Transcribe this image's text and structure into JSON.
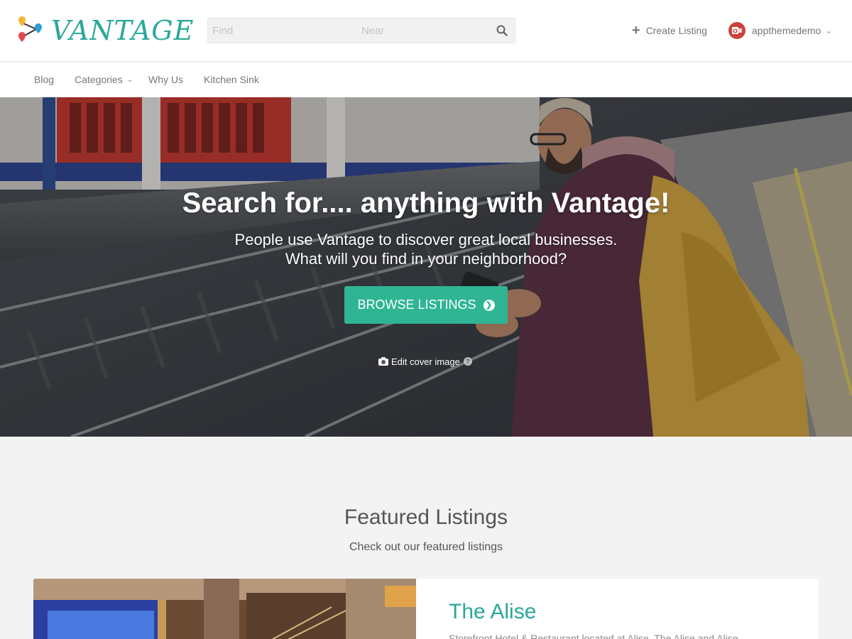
{
  "brand": {
    "name": "VANTAGE",
    "color": "#2aa89a"
  },
  "search": {
    "find_placeholder": "Find",
    "near_placeholder": "Near",
    "icon": "search-icon"
  },
  "header": {
    "create_listing_label": "Create Listing",
    "username": "appthemedemo"
  },
  "nav": {
    "items": [
      {
        "label": "Blog"
      },
      {
        "label": "Categories",
        "has_dropdown": true
      },
      {
        "label": "Why Us"
      },
      {
        "label": "Kitchen Sink"
      }
    ]
  },
  "hero": {
    "title": "Search for.... anything with Vantage!",
    "subtitle_line1": "People use Vantage to discover great local businesses.",
    "subtitle_line2": "What will you find in your neighborhood?",
    "button_label": "BROWSE LISTINGS",
    "button_color": "#2fb594",
    "edit_cover_label": "Edit cover image"
  },
  "featured": {
    "title": "Featured Listings",
    "subtitle": "Check out our featured listings",
    "listings": [
      {
        "title": "The Alise",
        "description": "Storefront Hotel & Restaurant located at Alise. The Alise and Alise"
      }
    ]
  }
}
